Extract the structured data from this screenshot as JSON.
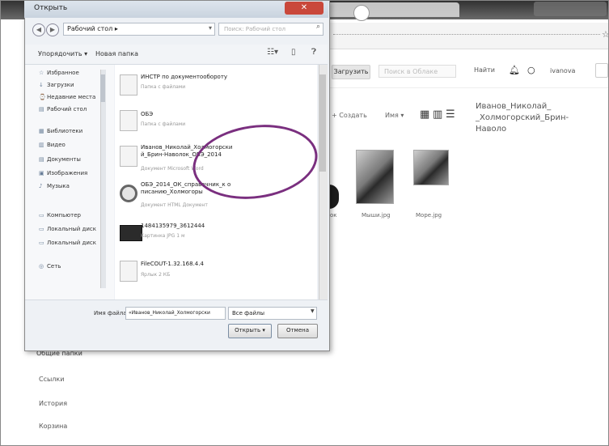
{
  "browser": {
    "address_icon": "☆",
    "upload_label": "Загрузить",
    "search_placeholder": "Поиск в Облаке",
    "find_label": "Найти",
    "user_name": "ivanova",
    "toolbar_create": "+ Создать",
    "toolbar_sort": "Имя ▾",
    "detail_title": "Иванов_Николай_ _Холмогорский_Брин- Наволо",
    "thumb_labels": [
      "ок",
      "Мыши.jpg",
      "Море.jpg"
    ]
  },
  "cloud_sidebar": {
    "title": "Общие папки",
    "items": [
      "Ссылки",
      "История",
      "Корзина"
    ]
  },
  "dialog": {
    "title": "Открыть",
    "close_label": "✕",
    "breadcrumb": "Рабочий стол ▸",
    "search_placeholder": "Поиск: Рабочий стол",
    "organize_label": "Упорядочить ▾",
    "new_folder_label": "Новая папка",
    "nav_items": [
      {
        "icon": "☆",
        "label": "Избранное"
      },
      {
        "icon": "↓",
        "label": "Загрузки"
      },
      {
        "icon": "⌚",
        "label": "Недавние места"
      },
      {
        "icon": "▤",
        "label": "Рабочий стол"
      },
      {
        "icon": "▦",
        "label": "Библиотеки"
      },
      {
        "icon": "▥",
        "label": "Видео"
      },
      {
        "icon": "▤",
        "label": "Документы"
      },
      {
        "icon": "▣",
        "label": "Изображения"
      },
      {
        "icon": "♪",
        "label": "Музыка"
      },
      {
        "icon": "▭",
        "label": "Компьютер"
      },
      {
        "icon": "▭",
        "label": "Локальный диск"
      },
      {
        "icon": "▭",
        "label": "Локальный диск"
      },
      {
        "icon": "◎",
        "label": "Сеть"
      }
    ],
    "files": [
      {
        "name": "ИНСТР по документообороту",
        "meta": "Папка с файлами"
      },
      {
        "name": "ОБЭ",
        "meta": "Папка с файлами"
      },
      {
        "name": "Иванов_Николай_Холмогорски й_Брин-Наволок_ОБЭ_2014",
        "meta": "Документ Microsoft Word"
      },
      {
        "name": "ОБЭ_2014_ОК_справочник_к о писанию_Холмогоры",
        "meta": "Документ HTML Документ"
      },
      {
        "name": "1484135979_3612444",
        "meta": "Картинка JPG 1 м"
      },
      {
        "name": "FileCOUT-1.32.168.4.4",
        "meta": "Ярлык 2 КБ"
      }
    ],
    "filename_label": "Имя файла:",
    "filename_value": "«Иванов_Николай_Холмогорски",
    "filetype_value": "Все файлы",
    "open_label": "Открыть ▾",
    "cancel_label": "Отмена"
  }
}
